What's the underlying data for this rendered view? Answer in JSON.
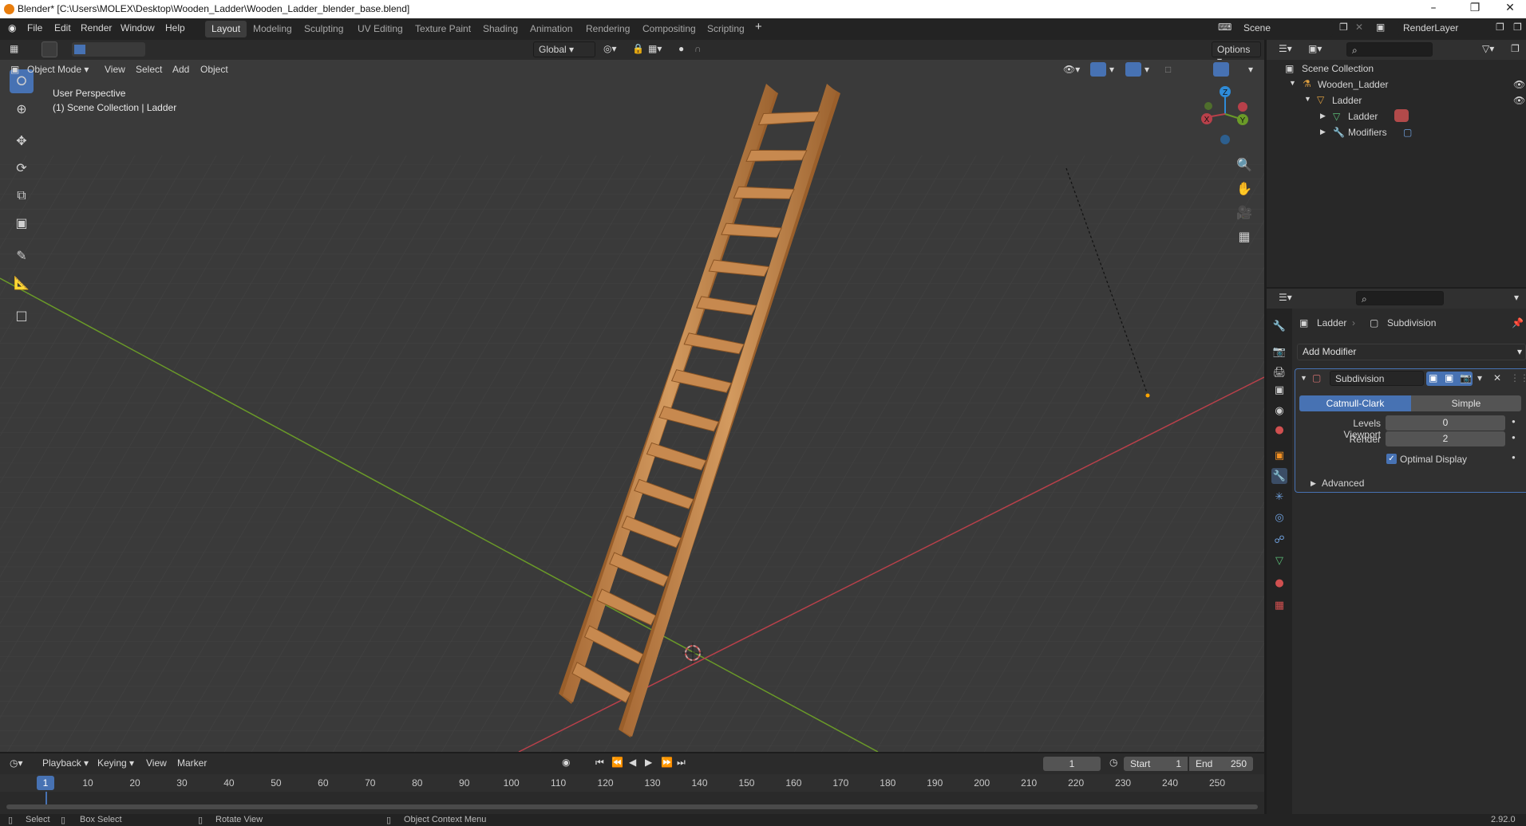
{
  "window": {
    "title": "Blender* [C:\\Users\\MOLEX\\Desktop\\Wooden_Ladder\\Wooden_Ladder_blender_base.blend]"
  },
  "menu": [
    "File",
    "Edit",
    "Render",
    "Window",
    "Help"
  ],
  "workspaces": [
    "Layout",
    "Modeling",
    "Sculpting",
    "UV Editing",
    "Texture Paint",
    "Shading",
    "Animation",
    "Rendering",
    "Compositing",
    "Scripting"
  ],
  "active_workspace": "Layout",
  "scene": {
    "name": "Scene",
    "render_layer": "RenderLayer"
  },
  "viewport_header": {
    "mode": "Object Mode",
    "menus": [
      "View",
      "Select",
      "Add",
      "Object"
    ],
    "transform": "Global",
    "options": "Options"
  },
  "viewport": {
    "perspective": "User Perspective",
    "collection_info": "(1) Scene Collection | Ladder",
    "axis_x": "X",
    "axis_y": "Y",
    "axis_z": "Z"
  },
  "outliner": {
    "root": "Scene Collection",
    "items": [
      {
        "label": "Wooden_Ladder",
        "icon": "armature-icon"
      },
      {
        "label": "Ladder",
        "icon": "object-icon"
      },
      {
        "label": "Ladder",
        "icon": "mesh-icon"
      },
      {
        "label": "Modifiers",
        "icon": "wrench-icon"
      }
    ]
  },
  "properties": {
    "breadcrumb_object": "Ladder",
    "breadcrumb_modifier": "Subdivision",
    "add_modifier": "Add Modifier",
    "modifier_name": "Subdivision",
    "tab_catmull": "Catmull-Clark",
    "tab_simple": "Simple",
    "levels_viewport_label": "Levels Viewport",
    "levels_viewport_value": "0",
    "render_label": "Render",
    "render_value": "2",
    "optimal_display": "Optimal Display",
    "optimal_display_checked": true,
    "advanced": "Advanced"
  },
  "timeline": {
    "menus": [
      "Playback",
      "Keying",
      "View",
      "Marker"
    ],
    "current_frame": "1",
    "start_label": "Start",
    "start": "1",
    "end_label": "End",
    "end": "250",
    "ticks": [
      "1",
      "10",
      "20",
      "30",
      "40",
      "50",
      "60",
      "70",
      "80",
      "90",
      "100",
      "110",
      "120",
      "130",
      "140",
      "150",
      "160",
      "170",
      "180",
      "190",
      "200",
      "210",
      "220",
      "230",
      "240",
      "250"
    ]
  },
  "statusbar": {
    "select": "Select",
    "box_select": "Box Select",
    "rotate": "Rotate View",
    "context": "Object Context Menu",
    "version": "2.92.0"
  },
  "colors": {
    "accent": "#4772b3",
    "wood": "#c7894f",
    "x_axis": "#b8404a",
    "y_axis": "#6a9a28",
    "z_axis": "#2e8bd8"
  }
}
